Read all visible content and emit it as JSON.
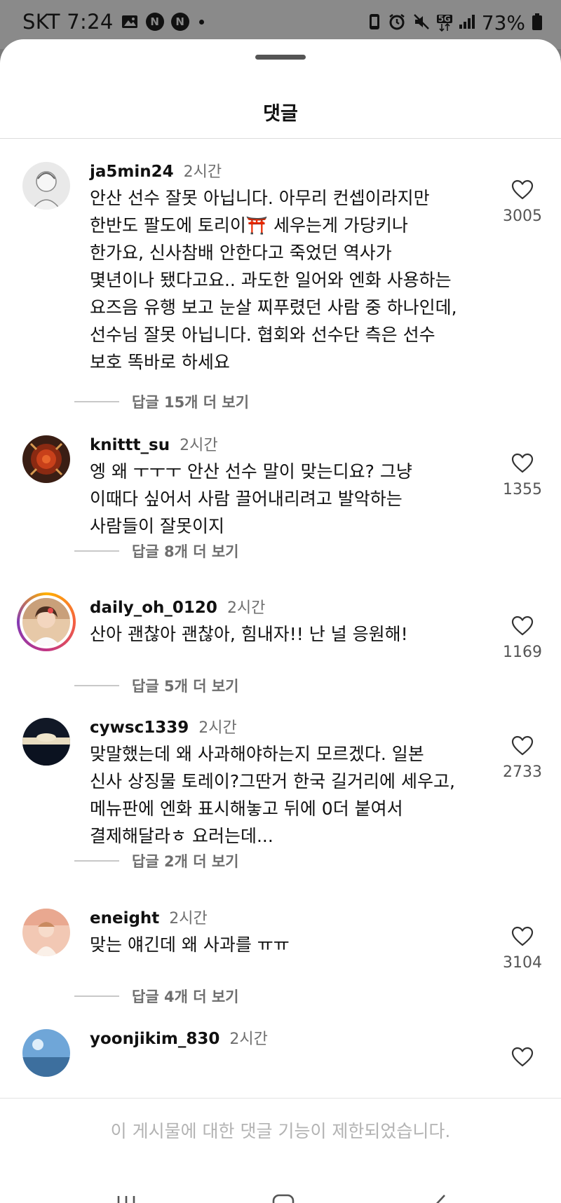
{
  "status_bar": {
    "carrier_time": "SKT 7:24",
    "battery": "73%",
    "network": "5G"
  },
  "sheet": {
    "title": "댓글"
  },
  "comments": [
    {
      "username": "ja5min24",
      "time": "2시간",
      "text": "안산 선수 잘못 아닙니다. 아무리 컨셉이라지만\n한반도 팔도에 토리이⛩️ 세우는게 가당키나\n한가요, 신사참배 안한다고 죽었던 역사가\n몇년이나 됐다고요.. 과도한 일어와 엔화 사용하는\n요즈음 유행 보고 눈살 찌푸렸던 사람 중 하나인데,\n선수님 잘못 아닙니다. 협회와 선수단 측은 선수\n보호 똑바로 하세요",
      "replies": "답글 15개 더 보기",
      "likes": "3005"
    },
    {
      "username": "knittt_su",
      "time": "2시간",
      "text": "엥 왜 ㅜㅜㅜ 안산 선수 말이 맞는디요? 그냥\n이때다 싶어서 사람 끌어내리려고 발악하는\n사람들이 잘못이지",
      "replies": "답글 8개 더 보기",
      "likes": "1355"
    },
    {
      "username": "daily_oh_0120",
      "time": "2시간",
      "text": "산아 괜찮아 괜찮아, 힘내자!! 난 널 응원해!",
      "replies": "답글 5개 더 보기",
      "likes": "1169"
    },
    {
      "username": "cywsc1339",
      "time": "2시간",
      "text": "맞말했는데 왜 사과해야하는지 모르겠다. 일본\n신사 상징물 토레이?그딴거 한국 길거리에 세우고,\n메뉴판에 엔화 표시해놓고 뒤에 0더 붙여서\n결제해달라ㅎ 요러는데...",
      "replies": "답글 2개 더 보기",
      "likes": "2733"
    },
    {
      "username": "eneight",
      "time": "2시간",
      "text": "맞는 얘긴데 왜 사과를 ㅠㅠ",
      "replies": "답글 4개 더 보기",
      "likes": "3104"
    },
    {
      "username": "yoonjikim_830",
      "time": "2시간"
    }
  ],
  "footer": {
    "restricted_notice": "이 게시물에 대한 댓글 기능이 제한되었습니다."
  },
  "icons": {
    "like": "heart-outline-icon",
    "nav_recent": "recent-apps-icon",
    "nav_home": "home-icon",
    "nav_back": "back-icon"
  }
}
